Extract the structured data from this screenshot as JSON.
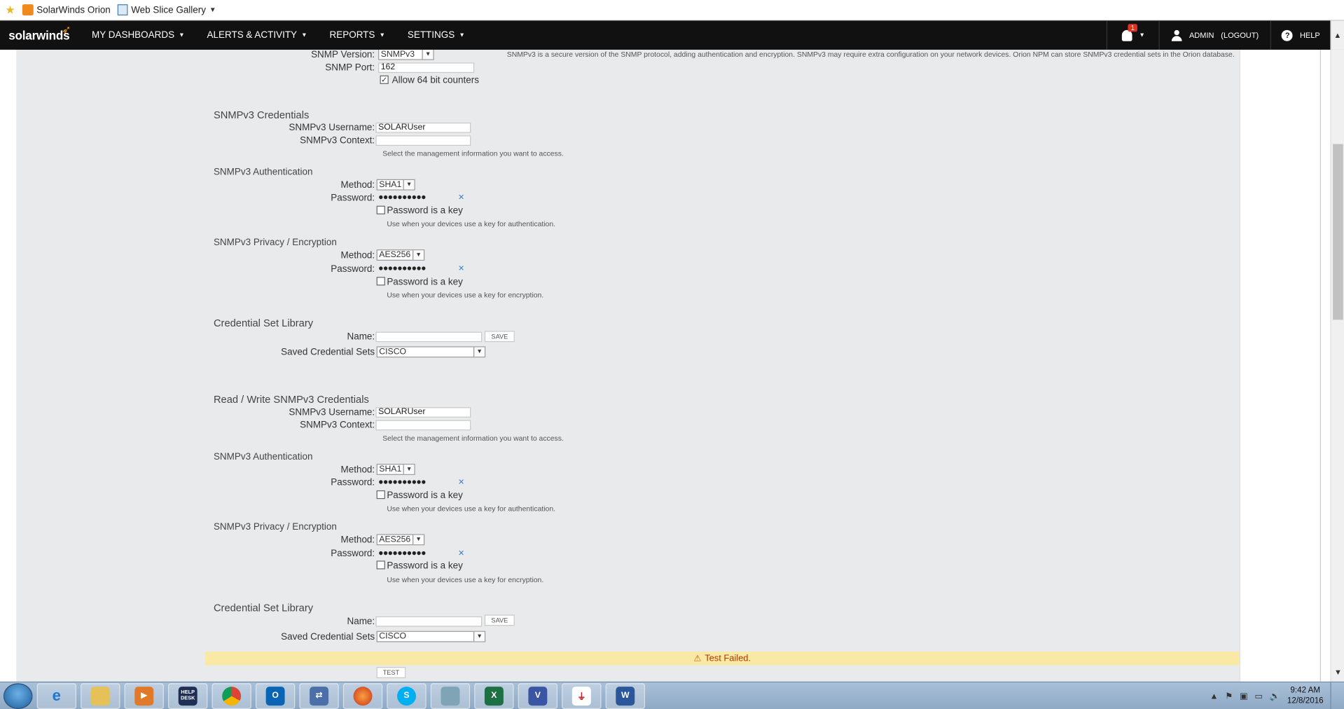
{
  "favorites": {
    "site_label": "SolarWinds Orion",
    "gallery_label": "Web Slice Gallery"
  },
  "nav": {
    "logo": "solarwinds",
    "items": [
      "MY DASHBOARDS",
      "ALERTS & ACTIVITY",
      "REPORTS",
      "SETTINGS"
    ],
    "alert_count": "1",
    "user_label": "ADMIN",
    "logout_label": "(LOGOUT)",
    "help_label": "HELP"
  },
  "snmp": {
    "version_label": "SNMP Version:",
    "version_value": "SNMPv3",
    "version_info": "SNMPv3 is a secure version of the SNMP protocol, adding authentication and encryption. SNMPv3 may require extra configuration on your network devices. Orion NPM can store SNMPv3 credential sets in the Orion database.",
    "port_label": "SNMP Port:",
    "port_value": "162",
    "counters_label": "Allow 64 bit counters",
    "counters_checked": true
  },
  "sections": [
    {
      "title": "SNMPv3 Credentials",
      "username_label": "SNMPv3 Username:",
      "username_value": "SOLARUser",
      "context_label": "SNMPv3 Context:",
      "context_value": "",
      "context_hint": "Select the management information you want to access.",
      "auth_title": "SNMPv3 Authentication",
      "auth_method_label": "Method:",
      "auth_method_value": "SHA1",
      "auth_password_label": "Password:",
      "auth_password_value": "●●●●●●●●●●",
      "auth_key_label": "Password is a key",
      "auth_key_hint": "Use when your devices use a key for authentication.",
      "priv_title": "SNMPv3 Privacy / Encryption",
      "priv_method_label": "Method:",
      "priv_method_value": "AES256",
      "priv_password_label": "Password:",
      "priv_password_value": "●●●●●●●●●●",
      "priv_key_label": "Password is a key",
      "priv_key_hint": "Use when your devices use a key for encryption.",
      "lib_title": "Credential Set Library",
      "lib_name_label": "Name:",
      "lib_save_label": "SAVE",
      "lib_saved_label": "Saved Credential Sets",
      "lib_saved_value": "CISCO"
    },
    {
      "title": "Read / Write SNMPv3 Credentials",
      "username_label": "SNMPv3 Username:",
      "username_value": "SOLARUser",
      "context_label": "SNMPv3 Context:",
      "context_value": "",
      "context_hint": "Select the management information you want to access.",
      "auth_title": "SNMPv3 Authentication",
      "auth_method_label": "Method:",
      "auth_method_value": "SHA1",
      "auth_password_label": "Password:",
      "auth_password_value": "●●●●●●●●●●",
      "auth_key_label": "Password is a key",
      "auth_key_hint": "Use when your devices use a key for authentication.",
      "priv_title": "SNMPv3 Privacy / Encryption",
      "priv_method_label": "Method:",
      "priv_method_value": "AES256",
      "priv_password_label": "Password:",
      "priv_password_value": "●●●●●●●●●●",
      "priv_key_label": "Password is a key",
      "priv_key_hint": "Use when your devices use a key for encryption.",
      "lib_title": "Credential Set Library",
      "lib_name_label": "Name:",
      "lib_save_label": "SAVE",
      "lib_saved_label": "Saved Credential Sets",
      "lib_saved_value": "CISCO"
    }
  ],
  "test": {
    "status": "Test Failed.",
    "button_label": "TEST"
  },
  "taskbar": {
    "helpdesk_label": "HELP DESK",
    "time": "9:42 AM",
    "date": "12/8/2016"
  },
  "colors": {
    "nav_bg": "#111111",
    "panel_bg": "#e9eaeb",
    "alert_bg": "#f9e9a4",
    "alert_text": "#b03a00",
    "brand_orange": "#f99d1c"
  }
}
